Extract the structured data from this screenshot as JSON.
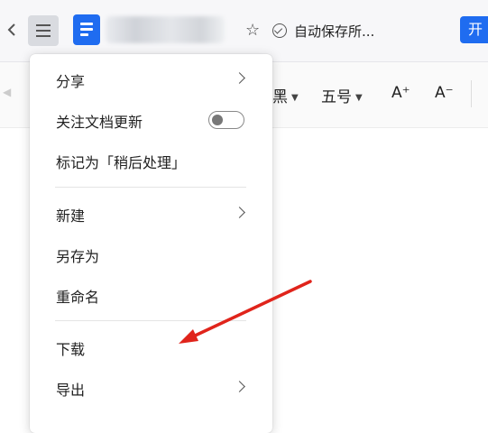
{
  "header": {
    "autosave_label": "自动保存所...",
    "open_button_label": "开"
  },
  "toolbar": {
    "font_name_partial": "黑",
    "font_size": "五号",
    "increase_font_label": "A⁺",
    "decrease_font_label": "A⁻"
  },
  "menu": {
    "items": [
      {
        "label": "分享",
        "has_submenu": true
      },
      {
        "label": "关注文档更新",
        "toggle_on": false
      },
      {
        "label": "标记为「稍后处理」"
      },
      {
        "label": "新建",
        "has_submenu": true
      },
      {
        "label": "另存为"
      },
      {
        "label": "重命名"
      },
      {
        "label": "下载"
      },
      {
        "label": "导出",
        "has_submenu": true
      }
    ]
  },
  "colors": {
    "accent": "#1f6cf0",
    "annotation_arrow": "#e0241b"
  },
  "icons": [
    "back-icon",
    "menu-icon",
    "document-icon",
    "star-icon",
    "check-circle-icon",
    "chevron-right-icon"
  ]
}
